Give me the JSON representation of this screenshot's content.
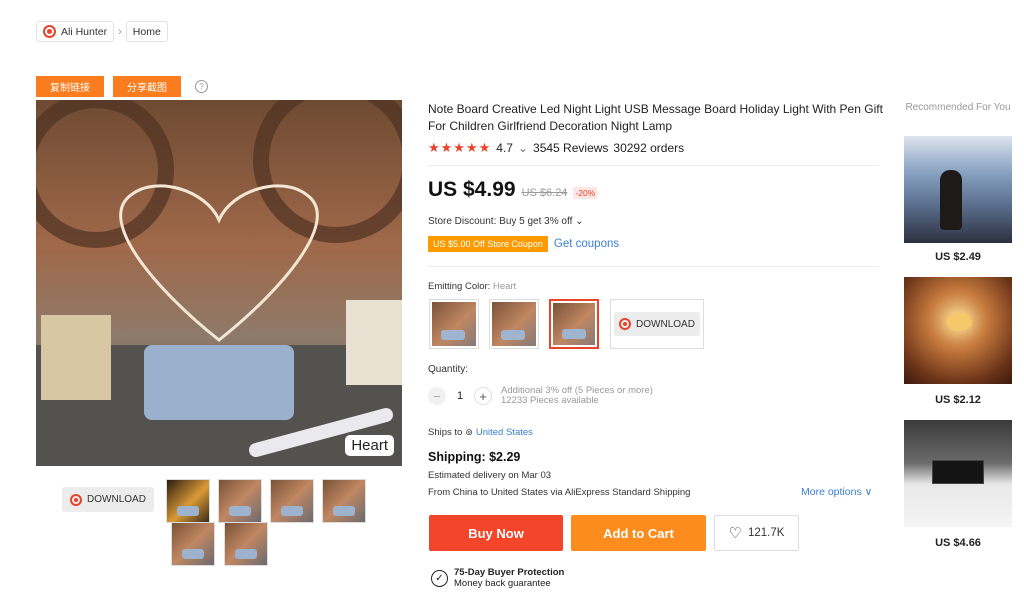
{
  "breadcrumb": {
    "items": [
      "Ali Hunter",
      "Home"
    ],
    "separator": "›"
  },
  "toolbar": {
    "copy_link": "复制链接",
    "share_screenshot": "分享截图",
    "help": "?"
  },
  "gallery": {
    "tag": "Heart",
    "download_label": "DOWNLOAD",
    "thumb_count": 7
  },
  "product": {
    "title": "Note Board Creative Led Night Light USB Message Board Holiday Light With Pen Gift For Children Girlfriend Decoration Night Lamp",
    "stars": "★★★★★",
    "rating": "4.7",
    "rating_chevron": "⌄",
    "reviews": "3545 Reviews",
    "orders": "30292 orders",
    "price": "US $4.99",
    "old_price": "US $6.24",
    "discount": "-20%",
    "store_discount": "Store Discount: Buy 5 get 3% off ⌄",
    "coupon": "US $5.00 Off Store Coupon",
    "get_coupons": "Get coupons",
    "color_label": "Emitting Color:",
    "color_value": "Heart",
    "swatch_download": "DOWNLOAD",
    "quantity_label": "Quantity:",
    "quantity": "1",
    "qty_minus": "−",
    "qty_plus": "+",
    "qty_note_1": "Additional 3% off (5 Pieces or more)",
    "qty_note_2": "12233 Pieces available",
    "ships_to_label": "Ships to",
    "ships_to": "United States",
    "shipping": "Shipping: $2.29",
    "estimated": "Estimated delivery on Mar 03",
    "from_text": "From China to United States via AliExpress Standard Shipping",
    "more_options": "More options ∨",
    "buy_now": "Buy Now",
    "add_to_cart": "Add to Cart",
    "wishlist_count": "121.7K",
    "heart_icon": "♡",
    "protection_title": "75-Day Buyer Protection",
    "protection_sub": "Money back guarantee",
    "protection_icon": "✓"
  },
  "recommended": {
    "title": "Recommended For You",
    "items": [
      {
        "price": "US $2.49"
      },
      {
        "price": "US $2.12"
      },
      {
        "price": "US $4.66"
      }
    ]
  },
  "colors": {
    "accent": "#e8432b",
    "buy": "#f3452a",
    "cart": "#fd8c1e",
    "coupon": "#fd9a00",
    "link": "#3a7fd4"
  }
}
